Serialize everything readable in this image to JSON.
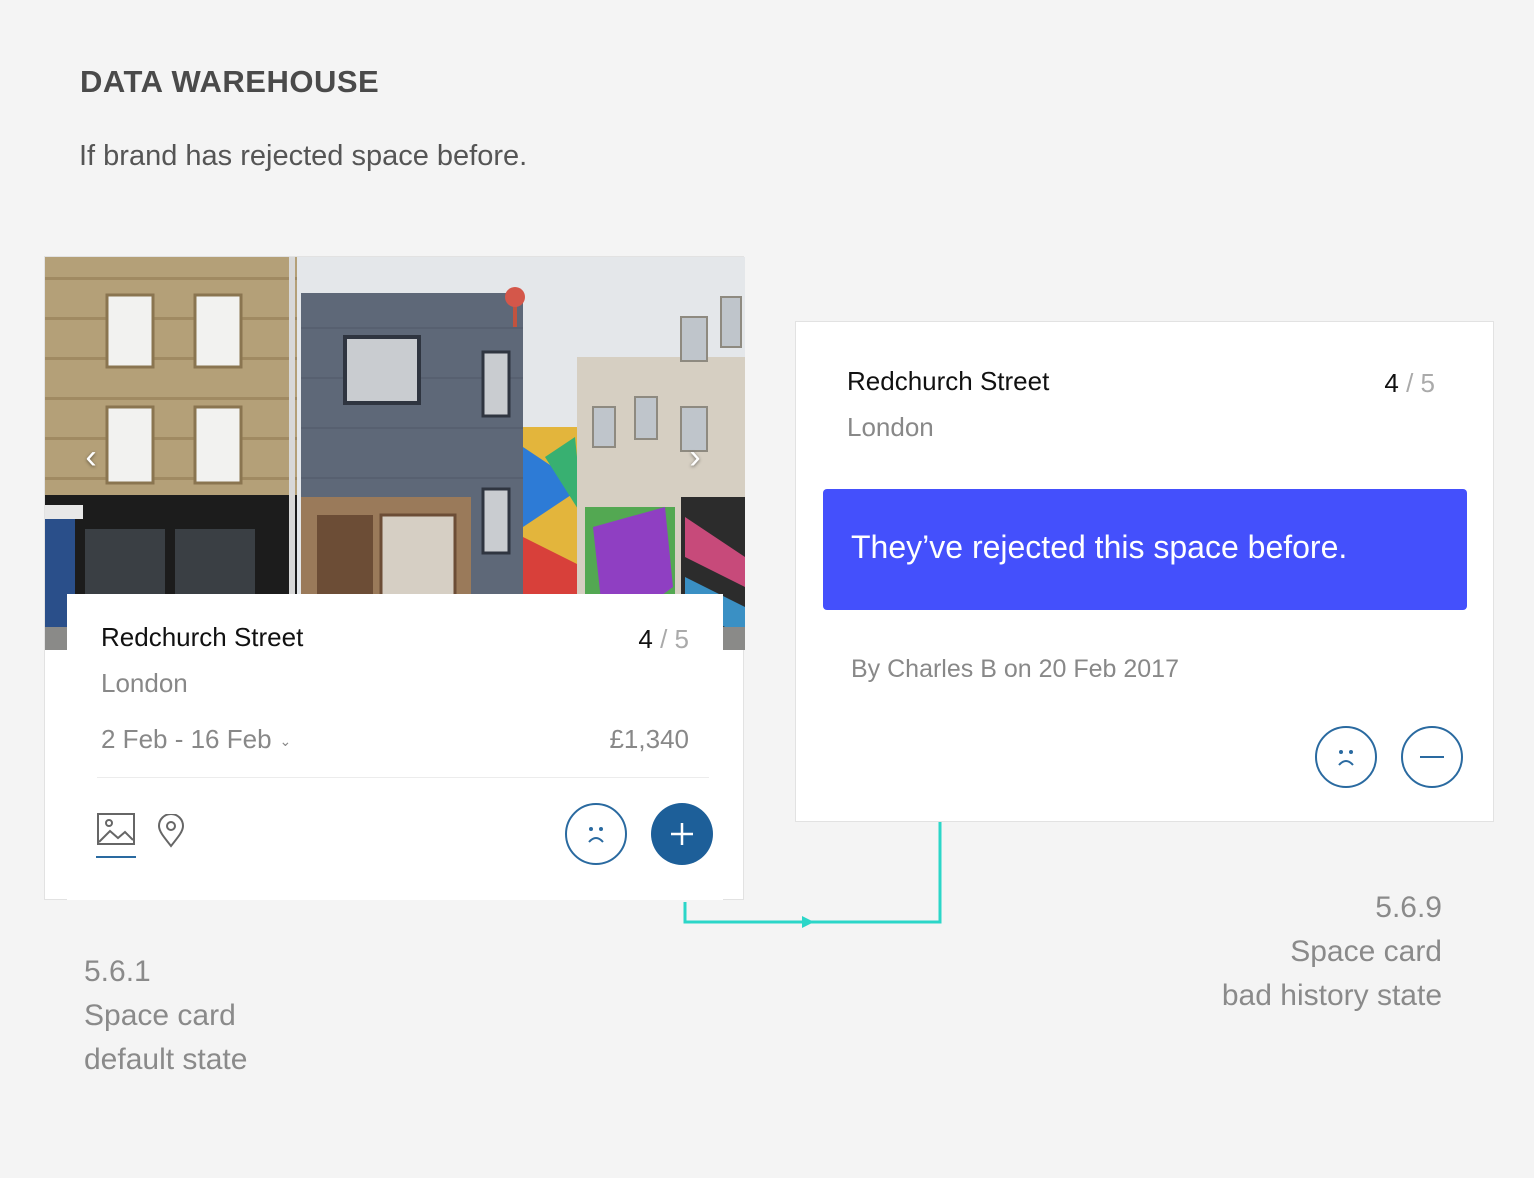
{
  "page": {
    "heading": "DATA WAREHOUSE",
    "subheading": "If brand has rejected space before."
  },
  "card_default": {
    "title": "Redchurch Street",
    "city": "London",
    "rating_value": "4",
    "rating_total": "/ 5",
    "dates": "2 Feb - 16 Feb",
    "price": "£1,340",
    "icons": [
      "image-icon",
      "map-pin-icon",
      "sad-face-icon",
      "plus-icon",
      "chevron-left-icon",
      "chevron-right-icon"
    ]
  },
  "card_bad_history": {
    "title": "Redchurch Street",
    "city": "London",
    "rating_value": "4",
    "rating_total": "/ 5",
    "alert": "They’ve rejected this space before.",
    "byline": "By Charles B on  20 Feb 2017",
    "icons": [
      "sad-face-icon",
      "minus-icon"
    ]
  },
  "captions": {
    "left": {
      "number": "5.6.1",
      "line1": "Space card",
      "line2": "default state"
    },
    "right": {
      "number": "5.6.9",
      "line1": "Space card",
      "line2": "bad history state"
    }
  },
  "colors": {
    "alert": "#4450fc",
    "button_primary": "#1d5f99",
    "connector": "#2bd6c8",
    "background": "#f4f4f4"
  }
}
